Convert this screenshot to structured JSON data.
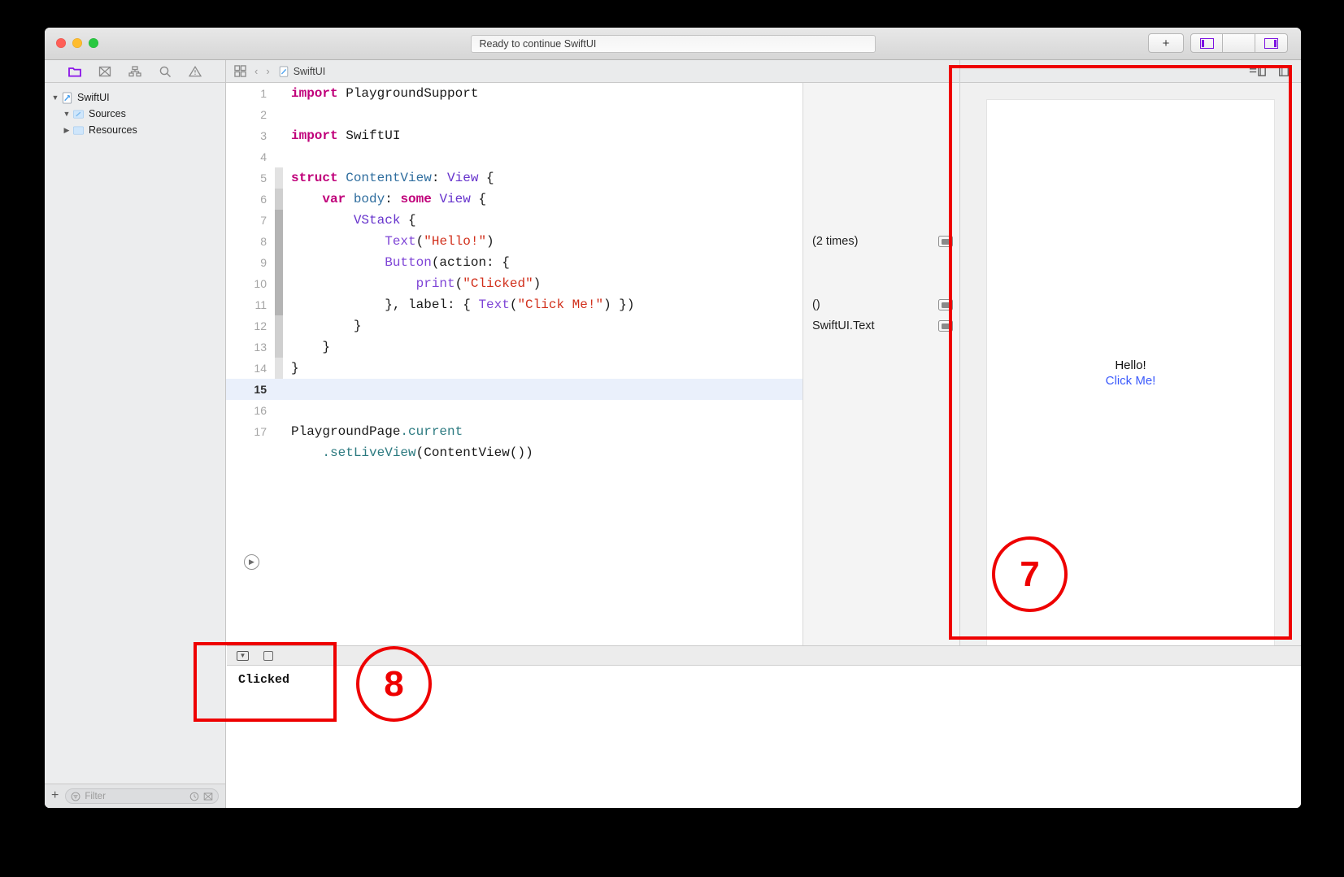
{
  "window": {
    "status_text": "Ready to continue SwiftUI",
    "traffic_lights": [
      "close-red",
      "minimize-yellow",
      "maximize-green"
    ],
    "toolbar_right": {
      "add_label": "+",
      "panel_left_icon": "left-panel-toggle-icon",
      "panel_bottom_icon": "bottom-panel-toggle-icon",
      "panel_right_icon": "right-panel-toggle-icon"
    }
  },
  "navigator": {
    "toolbar_icons": [
      "folder-icon",
      "source-control-icon",
      "hierarchy-icon",
      "search-icon",
      "warning-icon"
    ],
    "tree": [
      {
        "label": "SwiftUI",
        "level": 0,
        "twisty": "open",
        "icon": "playground-file-icon"
      },
      {
        "label": "Sources",
        "level": 1,
        "twisty": "open",
        "icon": "folder-blue-icon"
      },
      {
        "label": "Resources",
        "level": 1,
        "twisty": "closed",
        "icon": "folder-blue-icon"
      }
    ],
    "footer": {
      "add_label": "+",
      "filter_placeholder": "Filter",
      "filter_value": "",
      "icons": [
        "filter-icon",
        "recent-clock-icon",
        "source-control-filter-icon"
      ]
    }
  },
  "jumpbar": {
    "grid_icon": "related-items-icon",
    "back_icon": "chevron-left-icon",
    "forward_icon": "chevron-right-icon",
    "file_icon": "playground-file-icon",
    "file_name": "SwiftUI"
  },
  "editor": {
    "highlighted_line": 15,
    "run_button_icon": "execute-playground-icon",
    "lines": [
      {
        "n": 1,
        "fold": 0,
        "tokens": [
          {
            "t": "import",
            "c": "kw"
          },
          {
            "t": " PlaygroundSupport",
            "c": "pln"
          }
        ]
      },
      {
        "n": 2,
        "fold": 0,
        "tokens": []
      },
      {
        "n": 3,
        "fold": 0,
        "tokens": [
          {
            "t": "import",
            "c": "kw"
          },
          {
            "t": " SwiftUI",
            "c": "pln"
          }
        ]
      },
      {
        "n": 4,
        "fold": 0,
        "tokens": []
      },
      {
        "n": 5,
        "fold": 1,
        "tokens": [
          {
            "t": "struct",
            "c": "kw"
          },
          {
            "t": " ",
            "c": "pln"
          },
          {
            "t": "ContentView",
            "c": "type"
          },
          {
            "t": ": ",
            "c": "pln"
          },
          {
            "t": "View",
            "c": "type2"
          },
          {
            "t": " {",
            "c": "pln"
          }
        ]
      },
      {
        "n": 6,
        "fold": 2,
        "tokens": [
          {
            "t": "    ",
            "c": "pln"
          },
          {
            "t": "var",
            "c": "kw"
          },
          {
            "t": " ",
            "c": "pln"
          },
          {
            "t": "body",
            "c": "type"
          },
          {
            "t": ": ",
            "c": "pln"
          },
          {
            "t": "some",
            "c": "kw"
          },
          {
            "t": " ",
            "c": "pln"
          },
          {
            "t": "View",
            "c": "type2"
          },
          {
            "t": " {",
            "c": "pln"
          }
        ]
      },
      {
        "n": 7,
        "fold": 3,
        "tokens": [
          {
            "t": "        ",
            "c": "pln"
          },
          {
            "t": "VStack",
            "c": "type2"
          },
          {
            "t": " {",
            "c": "pln"
          }
        ]
      },
      {
        "n": 8,
        "fold": 3,
        "tokens": [
          {
            "t": "            ",
            "c": "pln"
          },
          {
            "t": "Text",
            "c": "fn"
          },
          {
            "t": "(",
            "c": "pln"
          },
          {
            "t": "\"Hello!\"",
            "c": "str"
          },
          {
            "t": ")",
            "c": "pln"
          }
        ]
      },
      {
        "n": 9,
        "fold": 3,
        "tokens": [
          {
            "t": "            ",
            "c": "pln"
          },
          {
            "t": "Button",
            "c": "fn"
          },
          {
            "t": "(action: {",
            "c": "pln"
          }
        ]
      },
      {
        "n": 10,
        "fold": 3,
        "tokens": [
          {
            "t": "                ",
            "c": "pln"
          },
          {
            "t": "print",
            "c": "fn"
          },
          {
            "t": "(",
            "c": "pln"
          },
          {
            "t": "\"Clicked\"",
            "c": "str"
          },
          {
            "t": ")",
            "c": "pln"
          }
        ]
      },
      {
        "n": 11,
        "fold": 3,
        "tokens": [
          {
            "t": "            }, label: { ",
            "c": "pln"
          },
          {
            "t": "Text",
            "c": "fn"
          },
          {
            "t": "(",
            "c": "pln"
          },
          {
            "t": "\"Click Me!\"",
            "c": "str"
          },
          {
            "t": ") })",
            "c": "pln"
          }
        ]
      },
      {
        "n": 12,
        "fold": 2,
        "tokens": [
          {
            "t": "        }",
            "c": "pln"
          }
        ]
      },
      {
        "n": 13,
        "fold": 2,
        "tokens": [
          {
            "t": "    }",
            "c": "pln"
          }
        ]
      },
      {
        "n": 14,
        "fold": 1,
        "tokens": [
          {
            "t": "}",
            "c": "pln"
          }
        ]
      },
      {
        "n": 15,
        "fold": 0,
        "tokens": []
      },
      {
        "n": 16,
        "fold": 0,
        "tokens": []
      },
      {
        "n": 17,
        "fold": 0,
        "tokens": [
          {
            "t": "PlaygroundPage",
            "c": "pln"
          },
          {
            "t": ".current",
            "c": "mth"
          }
        ]
      },
      {
        "n": "",
        "fold": 0,
        "tokens": [
          {
            "t": "    ",
            "c": "pln"
          },
          {
            "t": ".setLiveView",
            "c": "mth"
          },
          {
            "t": "(",
            "c": "pln"
          },
          {
            "t": "ContentView",
            "c": "pln"
          },
          {
            "t": "())",
            "c": "pln"
          }
        ]
      }
    ]
  },
  "results": {
    "rows": [
      {
        "label": "(2 times)",
        "line": 8,
        "quicklook": true
      },
      {
        "label": "()",
        "line": 11,
        "quicklook": true
      },
      {
        "label": "SwiftUI.Text",
        "line": 12,
        "quicklook": true
      }
    ]
  },
  "liveview": {
    "toolbar_icons": [
      "layout-mode-icon",
      "inspector-toggle-icon"
    ],
    "preview": {
      "hello_text": "Hello!",
      "button_text": "Click Me!",
      "button_color": "#3b5afc"
    }
  },
  "debug_area": {
    "toolbar_icons": [
      "console-filter-icon",
      "stop-square-icon"
    ],
    "console_output": "Clicked"
  },
  "annotations": {
    "accent_color": "#ee0000",
    "markers": [
      {
        "label": "7",
        "target": "live-view-panel"
      },
      {
        "label": "8",
        "target": "console-output"
      }
    ]
  }
}
